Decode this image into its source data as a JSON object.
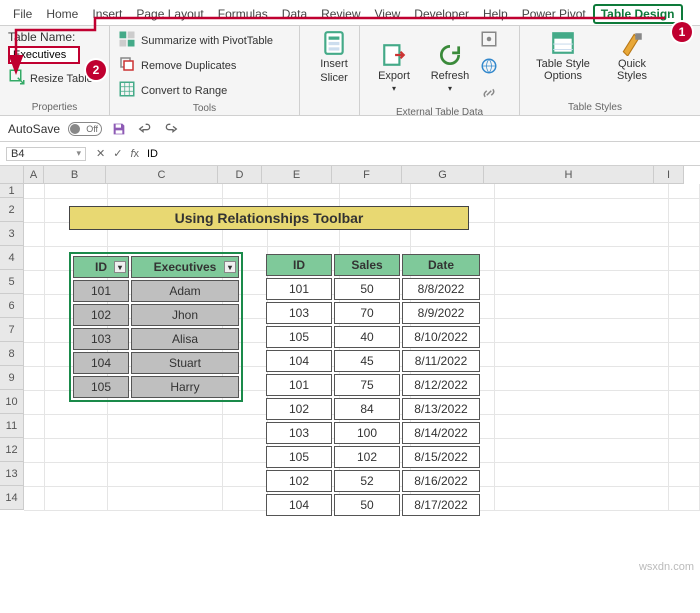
{
  "tabs": [
    "File",
    "Home",
    "Insert",
    "Page Layout",
    "Formulas",
    "Data",
    "Review",
    "View",
    "Developer",
    "Help",
    "Power Pivot",
    "Table Design"
  ],
  "active_tab_index": 11,
  "ribbon": {
    "properties": {
      "label_tablename": "Table Name:",
      "tablename_value": "Executives",
      "resize_label": "Resize Table",
      "group_label": "Properties"
    },
    "tools": {
      "pivot": "Summarize with PivotTable",
      "dup": "Remove Duplicates",
      "range": "Convert to Range",
      "group_label": "Tools"
    },
    "slicer": {
      "line1": "Insert",
      "line2": "Slicer"
    },
    "external": {
      "export": "Export",
      "refresh": "Refresh",
      "group_label": "External Table Data"
    },
    "styles": {
      "options": "Table Style Options",
      "quick": "Quick Styles",
      "group_label": "Table Styles"
    }
  },
  "autosave": {
    "label": "AutoSave",
    "state": "Off"
  },
  "namebox": "B4",
  "formula": "ID",
  "columns": [
    "A",
    "B",
    "C",
    "D",
    "E",
    "F",
    "G",
    "H",
    "I"
  ],
  "rows": [
    "1",
    "2",
    "3",
    "4",
    "5",
    "6",
    "7",
    "8",
    "9",
    "10",
    "11",
    "12",
    "13",
    "14"
  ],
  "title": "Using Relationships Toolbar",
  "tableA": {
    "headers": [
      "ID",
      "Executives"
    ],
    "rows": [
      [
        "101",
        "Adam"
      ],
      [
        "102",
        "Jhon"
      ],
      [
        "103",
        "Alisa"
      ],
      [
        "104",
        "Stuart"
      ],
      [
        "105",
        "Harry"
      ]
    ]
  },
  "tableB": {
    "headers": [
      "ID",
      "Sales",
      "Date"
    ],
    "rows": [
      [
        "101",
        "50",
        "8/8/2022"
      ],
      [
        "103",
        "70",
        "8/9/2022"
      ],
      [
        "105",
        "40",
        "8/10/2022"
      ],
      [
        "104",
        "45",
        "8/11/2022"
      ],
      [
        "101",
        "75",
        "8/12/2022"
      ],
      [
        "102",
        "84",
        "8/13/2022"
      ],
      [
        "103",
        "100",
        "8/14/2022"
      ],
      [
        "105",
        "102",
        "8/15/2022"
      ],
      [
        "102",
        "52",
        "8/16/2022"
      ],
      [
        "104",
        "50",
        "8/17/2022"
      ]
    ]
  },
  "badges": {
    "b1": "1",
    "b2": "2"
  },
  "watermark": "wsxdn.com"
}
